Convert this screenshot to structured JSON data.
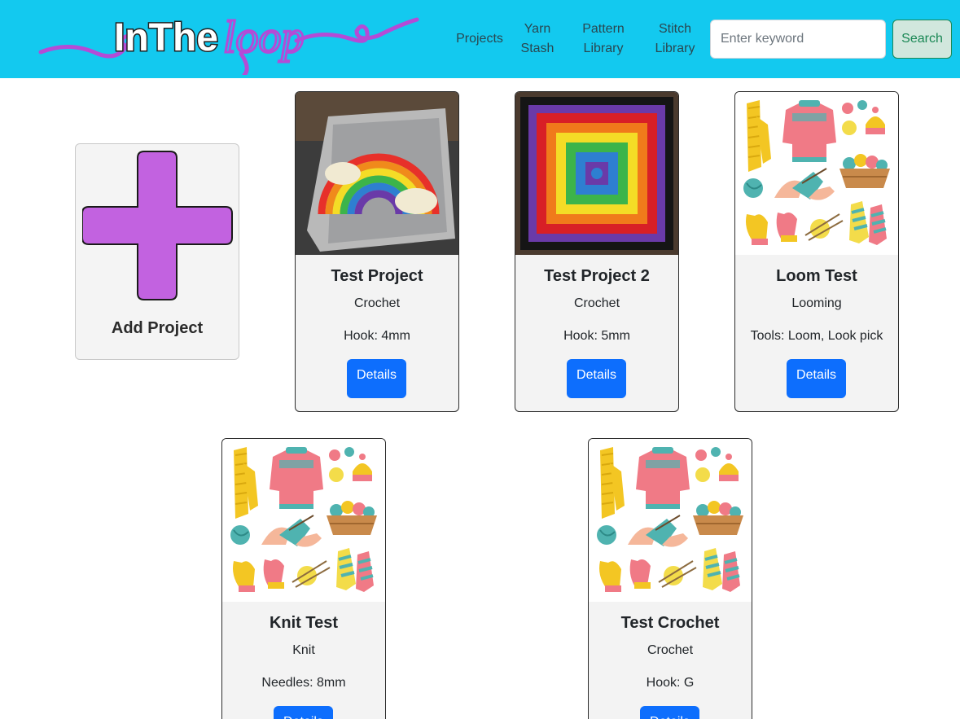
{
  "header": {
    "logo_text_1": "InThe",
    "logo_text_2": "loop",
    "nav": [
      {
        "label": "Projects"
      },
      {
        "line1": "Yarn",
        "line2": "Stash"
      },
      {
        "line1": "Pattern",
        "line2": "Library"
      },
      {
        "line1": "Stitch",
        "line2": "Library"
      }
    ],
    "search": {
      "placeholder": "Enter keyword",
      "button_label": "Search"
    }
  },
  "add_project": {
    "label": "Add Project"
  },
  "projects": [
    {
      "title": "Test Project",
      "craft": "Crochet",
      "tool": "Hook: 4mm",
      "button": "Details",
      "image": "rainbow-granny-square"
    },
    {
      "title": "Test Project 2",
      "craft": "Crochet",
      "tool": "Hook: 5mm",
      "button": "Details",
      "image": "granny-square"
    },
    {
      "title": "Loom Test",
      "craft": "Looming",
      "tool": "Tools: Loom, Look pick",
      "button": "Details",
      "image": "knitting-illustration"
    },
    {
      "title": "Knit Test",
      "craft": "Knit",
      "tool": "Needles: 8mm",
      "button": "Details",
      "image": "knitting-illustration"
    },
    {
      "title": "Test Crochet",
      "craft": "Crochet",
      "tool": "Hook: G",
      "button": "Details",
      "image": "knitting-illustration"
    }
  ],
  "colors": {
    "navbar": "#13c9ef",
    "logo_purple": "#b44bd6",
    "primary_button": "#0d6efd",
    "search_button": "#198754",
    "plus": "#c262e0"
  }
}
